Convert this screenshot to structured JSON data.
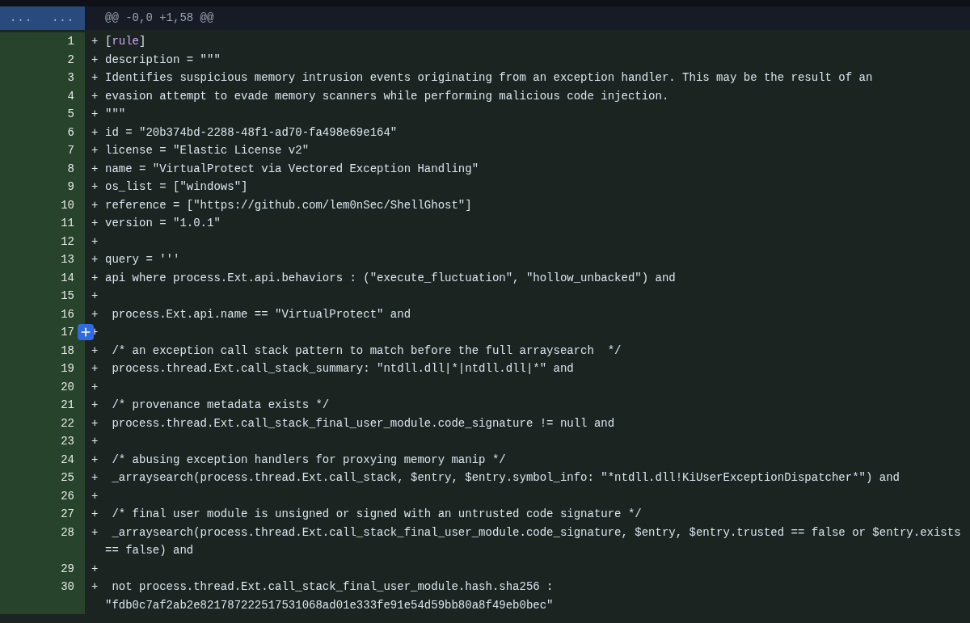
{
  "hunk_header": {
    "old_marker": "...",
    "new_marker": "...",
    "text": "@@ -0,0 +1,58 @@"
  },
  "lines": [
    {
      "number": "1",
      "sign": "+",
      "comment_button": false,
      "parts": [
        {
          "text": "[",
          "kind": "plain"
        },
        {
          "text": "rule",
          "kind": "section"
        },
        {
          "text": "]",
          "kind": "plain"
        }
      ]
    },
    {
      "number": "2",
      "sign": "+",
      "comment_button": false,
      "text": "description = \"\"\""
    },
    {
      "number": "3",
      "sign": "+",
      "comment_button": false,
      "text": "Identifies suspicious memory intrusion events originating from an exception handler. This may be the result of an"
    },
    {
      "number": "4",
      "sign": "+",
      "comment_button": false,
      "text": "evasion attempt to evade memory scanners while performing malicious code injection."
    },
    {
      "number": "5",
      "sign": "+",
      "comment_button": false,
      "text": "\"\"\""
    },
    {
      "number": "6",
      "sign": "+",
      "comment_button": false,
      "text": "id = \"20b374bd-2288-48f1-ad70-fa498e69e164\""
    },
    {
      "number": "7",
      "sign": "+",
      "comment_button": false,
      "text": "license = \"Elastic License v2\""
    },
    {
      "number": "8",
      "sign": "+",
      "comment_button": false,
      "text": "name = \"VirtualProtect via Vectored Exception Handling\""
    },
    {
      "number": "9",
      "sign": "+",
      "comment_button": false,
      "text": "os_list = [\"windows\"]"
    },
    {
      "number": "10",
      "sign": "+",
      "comment_button": false,
      "text": "reference = [\"https://github.com/lem0nSec/ShellGhost\"]"
    },
    {
      "number": "11",
      "sign": "+",
      "comment_button": false,
      "text": "version = \"1.0.1\""
    },
    {
      "number": "12",
      "sign": "+",
      "comment_button": false
    },
    {
      "number": "13",
      "sign": "+",
      "comment_button": false,
      "text": "query = '''"
    },
    {
      "number": "14",
      "sign": "+",
      "comment_button": false,
      "text": "api where process.Ext.api.behaviors : (\"execute_fluctuation\", \"hollow_unbacked\") and"
    },
    {
      "number": "15",
      "sign": "+",
      "comment_button": false
    },
    {
      "number": "16",
      "sign": "+",
      "comment_button": false,
      "text": " process.Ext.api.name == \"VirtualProtect\" and"
    },
    {
      "number": "17",
      "sign": "+",
      "comment_button": true
    },
    {
      "number": "18",
      "sign": "+",
      "comment_button": false,
      "text": " /* an exception call stack pattern to match before the full arraysearch  */"
    },
    {
      "number": "19",
      "sign": "+",
      "comment_button": false,
      "text": " process.thread.Ext.call_stack_summary: \"ntdll.dll|*|ntdll.dll|*\" and"
    },
    {
      "number": "20",
      "sign": "+",
      "comment_button": false
    },
    {
      "number": "21",
      "sign": "+",
      "comment_button": false,
      "text": " /* provenance metadata exists */"
    },
    {
      "number": "22",
      "sign": "+",
      "comment_button": false,
      "text": " process.thread.Ext.call_stack_final_user_module.code_signature != null and"
    },
    {
      "number": "23",
      "sign": "+",
      "comment_button": false
    },
    {
      "number": "24",
      "sign": "+",
      "comment_button": false,
      "text": " /* abusing exception handlers for proxying memory manip */"
    },
    {
      "number": "25",
      "sign": "+",
      "comment_button": false,
      "text": " _arraysearch(process.thread.Ext.call_stack, $entry, $entry.symbol_info: \"*ntdll.dll!KiUserExceptionDispatcher*\") and"
    },
    {
      "number": "26",
      "sign": "+",
      "comment_button": false
    },
    {
      "number": "27",
      "sign": "+",
      "comment_button": false,
      "text": " /* final user module is unsigned or signed with an untrusted code signature */"
    },
    {
      "number": "28",
      "sign": "+",
      "comment_button": false,
      "text": " _arraysearch(process.thread.Ext.call_stack_final_user_module.code_signature, $entry, $entry.trusted == false or $entry.exists",
      "continuation": "== false) and"
    },
    {
      "number": "29",
      "sign": "+",
      "comment_button": false
    },
    {
      "number": "30",
      "sign": "+",
      "comment_button": false,
      "text": " not process.thread.Ext.call_stack_final_user_module.hash.sha256 :",
      "continuation": "\"fdb0c7af2ab2e821787222517531068ad01e333fe91e54d59bb80a8f49eb0bec\""
    }
  ]
}
